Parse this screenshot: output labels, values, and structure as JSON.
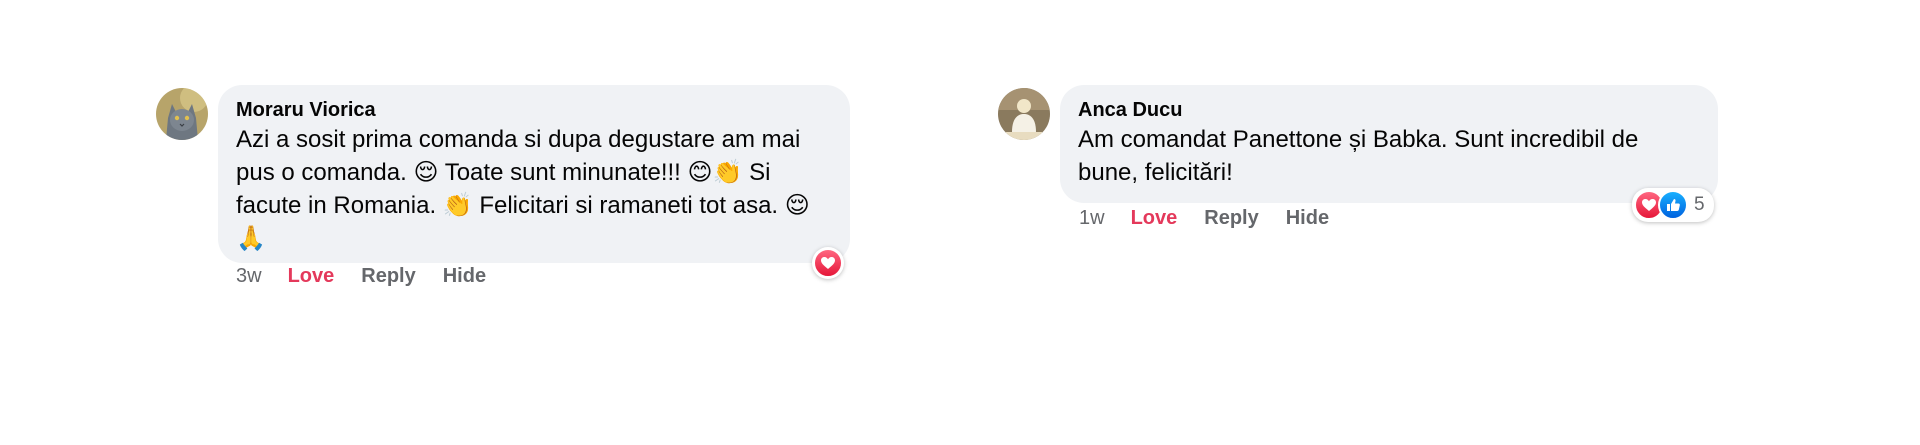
{
  "comments": [
    {
      "author": "Moraru Viorica",
      "text_lines": [
        "Azi a sosit prima comanda si dupa degustare am mai",
        "pus o comanda. 😌 Toate sunt minunate!!! 😊👏 Si",
        "facute in Romania. 👏 Felicitari si ramaneti tot asa. 😌",
        "🙏"
      ],
      "time": "3w",
      "love_label": "Love",
      "reply_label": "Reply",
      "hide_label": "Hide",
      "reactions": {
        "icons": [
          "heart-icon"
        ],
        "count": ""
      },
      "avatar_icon": "cat-avatar"
    },
    {
      "author": "Anca Ducu",
      "text_lines": [
        "Am comandat Panettone și Babka. Sunt incredibil de",
        "bune, felicitări!"
      ],
      "time": "1w",
      "love_label": "Love",
      "reply_label": "Reply",
      "hide_label": "Hide",
      "reactions": {
        "icons": [
          "heart-icon",
          "thumbs-up-icon"
        ],
        "count": "5"
      },
      "avatar_icon": "person-avatar"
    }
  ],
  "colors": {
    "bubble": "#f0f2f5",
    "love": "#e4395b",
    "meta": "#65676b",
    "like": "#1877f2"
  }
}
